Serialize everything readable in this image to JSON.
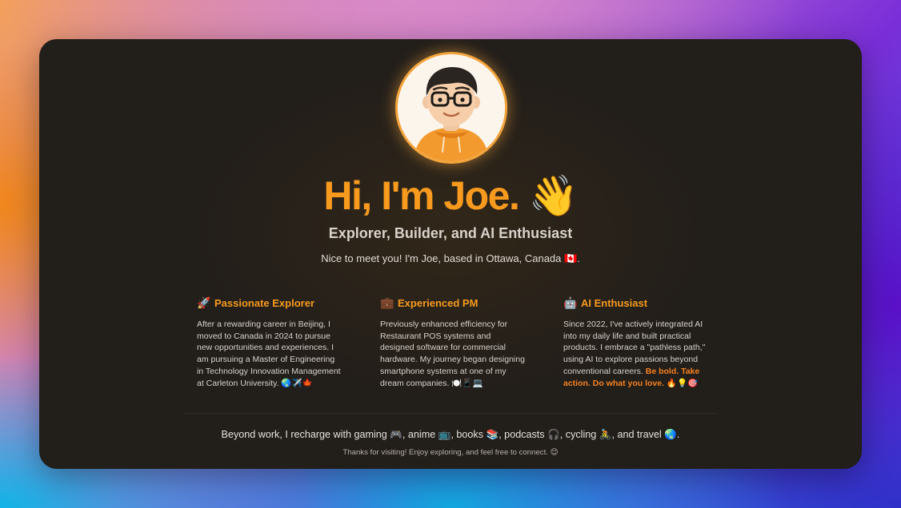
{
  "profile": {
    "avatar_alt": "Joe avatar",
    "title": "Hi, I'm Joe.",
    "title_emoji": "👋",
    "subtitle": "Explorer, Builder, and AI Enthusiast",
    "intro": "Nice to meet you! I'm Joe, based in Ottawa, Canada 🇨🇦."
  },
  "cards": [
    {
      "icon": "🚀",
      "icon_name": "rocket-icon",
      "title": "Passionate Explorer",
      "body": "After a rewarding career in Beijing, I moved to Canada in 2024 to pursue new opportunities and experiences. I am pursuing a Master of Engineering in Technology Innovation Management at Carleton University. 🌏✈️🍁"
    },
    {
      "icon": "💼",
      "icon_name": "briefcase-icon",
      "title": "Experienced PM",
      "body": "Previously enhanced efficiency for Restaurant POS systems and designed software for commercial hardware. My journey began designing smartphone systems at one of my dream companies. 🍽️📱💻"
    },
    {
      "icon": "🤖",
      "icon_name": "robot-icon",
      "title": "AI Enthusiast",
      "body": "Since 2022, I've actively integrated AI into my daily life and built practical products. I embrace a \"pathless path,\" using AI to explore passions beyond conventional careers. ",
      "accent": "Be bold. Take action. Do what you love. 🔥💡🎯"
    }
  ],
  "footer": {
    "beyond": "Beyond work, I recharge with gaming 🎮, anime 📺, books 📚, podcasts 🎧, cycling 🚴, and travel 🌏.",
    "thanks": "Thanks for visiting! Enjoy exploring, and feel free to connect. 😊"
  },
  "colors": {
    "accent": "#f79a1e",
    "panel": "#221e1a",
    "text": "#d9d3cc"
  }
}
